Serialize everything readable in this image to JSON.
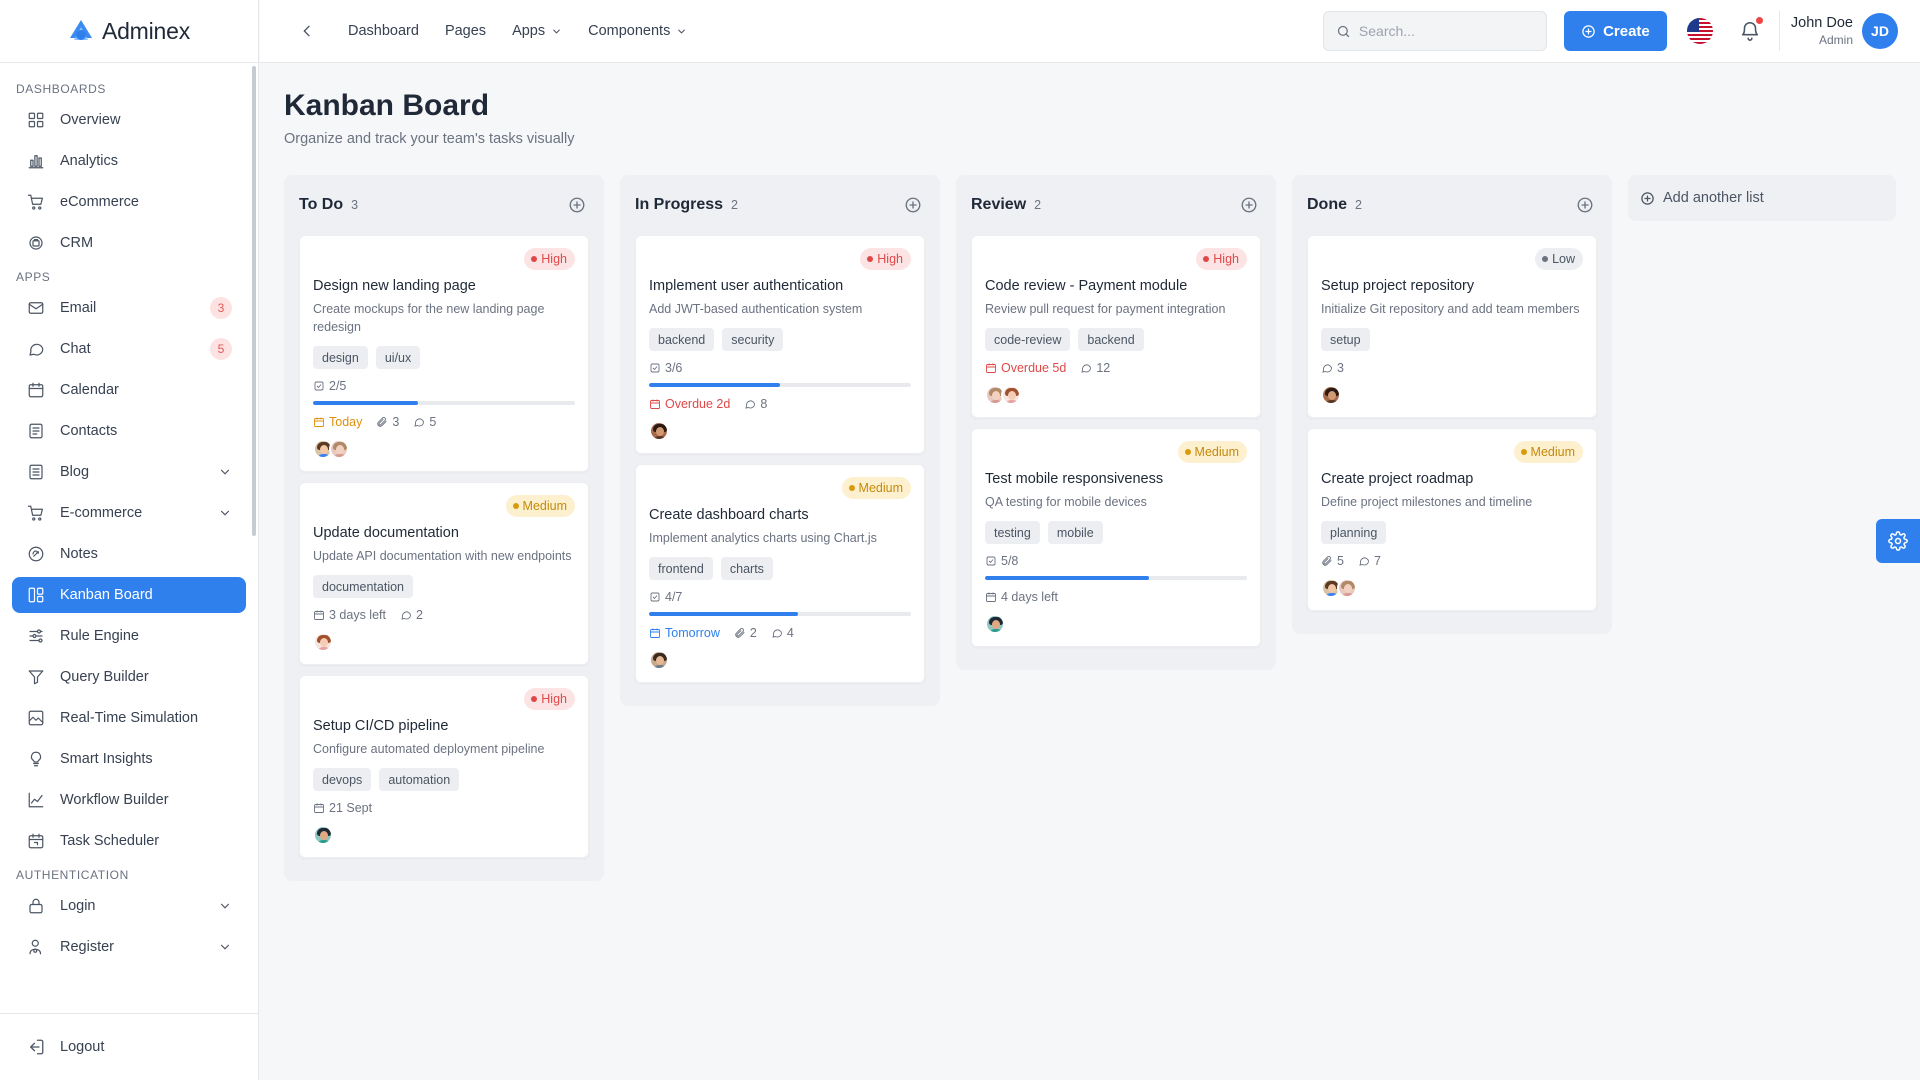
{
  "brand": {
    "name": "Adminex"
  },
  "sidebar": {
    "sections": {
      "dashboards": "Dashboards",
      "apps": "Apps",
      "authentication": "Authentication"
    },
    "dashboards": [
      {
        "label": "Overview",
        "icon": "grid-icon"
      },
      {
        "label": "Analytics",
        "icon": "bar-chart-icon"
      },
      {
        "label": "eCommerce",
        "icon": "cart-icon"
      },
      {
        "label": "CRM",
        "icon": "briefcase-icon"
      }
    ],
    "apps": [
      {
        "label": "Email",
        "icon": "mail-icon",
        "badge": "3"
      },
      {
        "label": "Chat",
        "icon": "chat-icon",
        "badge": "5"
      },
      {
        "label": "Calendar",
        "icon": "calendar-icon"
      },
      {
        "label": "Contacts",
        "icon": "contacts-icon"
      },
      {
        "label": "Blog",
        "icon": "blog-icon",
        "has_children": true
      },
      {
        "label": "E-commerce",
        "icon": "cart-icon",
        "has_children": true
      },
      {
        "label": "Notes",
        "icon": "notes-icon"
      },
      {
        "label": "Kanban Board",
        "icon": "kanban-icon",
        "active": true
      },
      {
        "label": "Rule Engine",
        "icon": "sliders-icon"
      },
      {
        "label": "Query Builder",
        "icon": "filter-icon"
      },
      {
        "label": "Real-Time Simulation",
        "icon": "image-chart-icon"
      },
      {
        "label": "Smart Insights",
        "icon": "lightbulb-icon"
      },
      {
        "label": "Workflow Builder",
        "icon": "line-chart-icon"
      },
      {
        "label": "Task Scheduler",
        "icon": "calendar-clock-icon"
      }
    ],
    "authentication": [
      {
        "label": "Login",
        "icon": "lock-icon",
        "has_children": true
      },
      {
        "label": "Register",
        "icon": "user-plus-icon",
        "has_children": true
      }
    ],
    "footer": {
      "label": "Logout",
      "icon": "logout-icon"
    }
  },
  "topbar": {
    "nav": [
      {
        "label": "Dashboard"
      },
      {
        "label": "Pages"
      },
      {
        "label": "Apps",
        "dropdown": true
      },
      {
        "label": "Components",
        "dropdown": true
      }
    ],
    "search_placeholder": "Search...",
    "create_label": "Create",
    "user": {
      "name": "John Doe",
      "role": "Admin",
      "initials": "JD"
    }
  },
  "page": {
    "title": "Kanban Board",
    "subtitle": "Organize and track your team's tasks visually"
  },
  "board": {
    "add_list_label": "Add another list",
    "columns": [
      {
        "title": "To Do",
        "count": "3",
        "cards": [
          {
            "priority": "High",
            "priority_level": "high",
            "title": "Design new landing page",
            "desc": "Create mockups for the new landing page redesign",
            "tags": [
              "design",
              "ui/ux"
            ],
            "checklist": "2/5",
            "progress": 0.4,
            "due": "Today",
            "due_style": "today",
            "attachments": "3",
            "comments": "5",
            "avatars": [
              "a1",
              "a2"
            ]
          },
          {
            "priority": "Medium",
            "priority_level": "medium",
            "title": "Update documentation",
            "desc": "Update API documentation with new endpoints",
            "tags": [
              "documentation"
            ],
            "due": "3 days left",
            "due_style": "normal",
            "comments": "2",
            "avatars": [
              "a3"
            ]
          },
          {
            "priority": "High",
            "priority_level": "high",
            "title": "Setup CI/CD pipeline",
            "desc": "Configure automated deployment pipeline",
            "tags": [
              "devops",
              "automation"
            ],
            "due": "21 Sept",
            "due_style": "normal",
            "avatars": [
              "a4"
            ]
          }
        ]
      },
      {
        "title": "In Progress",
        "count": "2",
        "cards": [
          {
            "priority": "High",
            "priority_level": "high",
            "title": "Implement user authentication",
            "desc": "Add JWT-based authentication system",
            "tags": [
              "backend",
              "security"
            ],
            "checklist": "3/6",
            "progress": 0.5,
            "due": "Overdue 2d",
            "due_style": "overdue",
            "comments": "8",
            "avatars": [
              "a5"
            ]
          },
          {
            "priority": "Medium",
            "priority_level": "medium",
            "title": "Create dashboard charts",
            "desc": "Implement analytics charts using Chart.js",
            "tags": [
              "frontend",
              "charts"
            ],
            "checklist": "4/7",
            "progress": 0.57,
            "due": "Tomorrow",
            "due_style": "tomorrow",
            "attachments": "2",
            "comments": "4",
            "avatars": [
              "a6"
            ]
          }
        ]
      },
      {
        "title": "Review",
        "count": "2",
        "cards": [
          {
            "priority": "High",
            "priority_level": "high",
            "title": "Code review - Payment module",
            "desc": "Review pull request for payment integration",
            "tags": [
              "code-review",
              "backend"
            ],
            "due": "Overdue 5d",
            "due_style": "overdue",
            "comments": "12",
            "avatars": [
              "a2",
              "a3"
            ]
          },
          {
            "priority": "Medium",
            "priority_level": "medium",
            "title": "Test mobile responsiveness",
            "desc": "QA testing for mobile devices",
            "tags": [
              "testing",
              "mobile"
            ],
            "checklist": "5/8",
            "progress": 0.625,
            "due": "4 days left",
            "due_style": "normal",
            "avatars": [
              "a4"
            ]
          }
        ]
      },
      {
        "title": "Done",
        "count": "2",
        "cards": [
          {
            "priority": "Low",
            "priority_level": "low",
            "title": "Setup project repository",
            "desc": "Initialize Git repository and add team members",
            "tags": [
              "setup"
            ],
            "comments": "3",
            "avatars": [
              "a5"
            ]
          },
          {
            "priority": "Medium",
            "priority_level": "medium",
            "title": "Create project roadmap",
            "desc": "Define project milestones and timeline",
            "tags": [
              "planning"
            ],
            "attachments": "5",
            "comments": "7",
            "avatars": [
              "a1",
              "a2"
            ]
          }
        ]
      }
    ]
  },
  "colors": {
    "accent": "#2f80ed",
    "high": "#e04848",
    "medium": "#d99a0d",
    "low": "#6b7280"
  }
}
